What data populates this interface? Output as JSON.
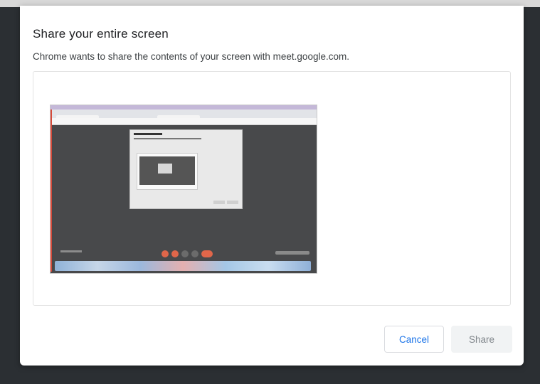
{
  "dialog": {
    "title": "Share your entire screen",
    "subtitle": "Chrome wants to share the contents of your screen with meet.google.com.",
    "cancel_label": "Cancel",
    "share_label": "Share"
  },
  "colors": {
    "accent": "#1a73e8",
    "disabled_text": "#80868b",
    "backdrop": "#2b2f33"
  },
  "icons": [
    "screen-thumbnail"
  ]
}
